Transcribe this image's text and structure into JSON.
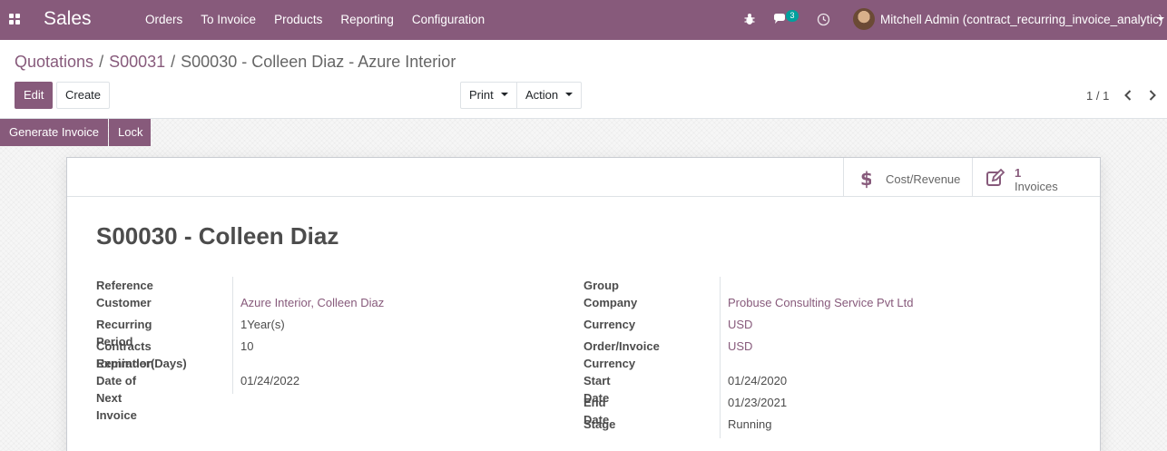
{
  "navbar": {
    "brand": "Sales",
    "menu": [
      "Orders",
      "To Invoice",
      "Products",
      "Reporting",
      "Configuration"
    ],
    "chat_count": "3",
    "user_name": "Mitchell Admin (contract_recurring_invoice_analytic)",
    "bar_color": "#875a7b"
  },
  "breadcrumb": {
    "items": [
      "Quotations",
      "S00031"
    ],
    "current": "S00030 - Colleen Diaz - Azure Interior"
  },
  "toolbar": {
    "edit_label": "Edit",
    "create_label": "Create",
    "print_label": "Print",
    "action_label": "Action"
  },
  "pager": {
    "value": "1 / 1"
  },
  "statusbar": {
    "generate_invoice_label": "Generate Invoice",
    "lock_label": "Lock"
  },
  "smart_buttons": {
    "cost_revenue_label": "Cost/Revenue",
    "invoices_count": "1",
    "invoices_label": "Invoices"
  },
  "record": {
    "title": "S00030 - Colleen Diaz",
    "left_fields": {
      "reference_label": "Reference",
      "customer_label": "Customer",
      "customer_value": "Azure Interior, Colleen Diaz",
      "recurring_period_label": "Recurring Period",
      "recurring_period_value": "1Year(s)",
      "contracts_expiration_label_1": "Contracts Expiration",
      "contracts_expiration_label_2": "Reminder(Days)",
      "contracts_expiration_value": "10",
      "next_invoice_label": "Date of Next Invoice",
      "next_invoice_value": "01/24/2022"
    },
    "right_fields": {
      "group_label": "Group",
      "company_label": "Company",
      "company_value": "Probuse Consulting Service Pvt Ltd",
      "currency_label": "Currency",
      "currency_value": "USD",
      "order_invoice_currency_label_1": "Order/Invoice",
      "order_invoice_currency_label_2": "Currency",
      "order_invoice_currency_value": "USD",
      "start_date_label": "Start Date",
      "start_date_value": "01/24/2020",
      "end_date_label": "End Date",
      "end_date_value": "01/23/2021",
      "stage_label": "Stage",
      "stage_value": "Running"
    }
  }
}
